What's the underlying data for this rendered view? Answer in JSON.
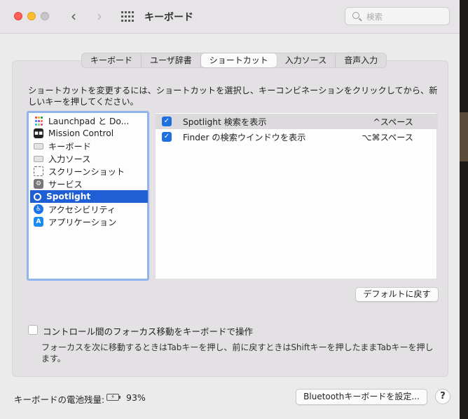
{
  "window": {
    "title": "キーボード",
    "search_placeholder": "検索"
  },
  "tabs": [
    {
      "label": "キーボード"
    },
    {
      "label": "ユーザ辞書"
    },
    {
      "label": "ショートカット"
    },
    {
      "label": "入力ソース"
    },
    {
      "label": "音声入力"
    }
  ],
  "instructions": "ショートカットを変更するには、ショートカットを選択し、キーコンビネーションをクリックしてから、新しいキーを押してください。",
  "categories": [
    {
      "label": "Launchpad と Do...",
      "icon": "launchpad-icon"
    },
    {
      "label": "Mission Control",
      "icon": "mission-control-icon"
    },
    {
      "label": "キーボード",
      "icon": "keyboard-icon"
    },
    {
      "label": "入力ソース",
      "icon": "keyboard-icon"
    },
    {
      "label": "スクリーンショット",
      "icon": "screenshot-icon"
    },
    {
      "label": "サービス",
      "icon": "gear-icon"
    },
    {
      "label": "Spotlight",
      "icon": "spotlight-icon",
      "selected": true
    },
    {
      "label": "アクセシビリティ",
      "icon": "accessibility-icon"
    },
    {
      "label": "アプリケーション",
      "icon": "app-store-icon"
    }
  ],
  "shortcuts": [
    {
      "label": "Spotlight 検索を表示",
      "key": "^スペース",
      "checked": true
    },
    {
      "label": "Finder の検索ウインドウを表示",
      "key": "⌥⌘スペース",
      "checked": true
    }
  ],
  "buttons": {
    "restore_default": "デフォルトに戻す",
    "bluetooth_setup": "Bluetoothキーボードを設定...",
    "help": "?"
  },
  "focus": {
    "label": "コントロール間のフォーカス移動をキーボードで操作",
    "description": "フォーカスを次に移動するときはTabキーを押し、前に戻すときはShiftキーを押したままTabキーを押します。"
  },
  "battery": {
    "label": "キーボードの電池残量:",
    "percent": "93%"
  },
  "colors": {
    "accent": "#1e5fd6",
    "close": "#ff5f57",
    "minimize": "#febc2e"
  }
}
